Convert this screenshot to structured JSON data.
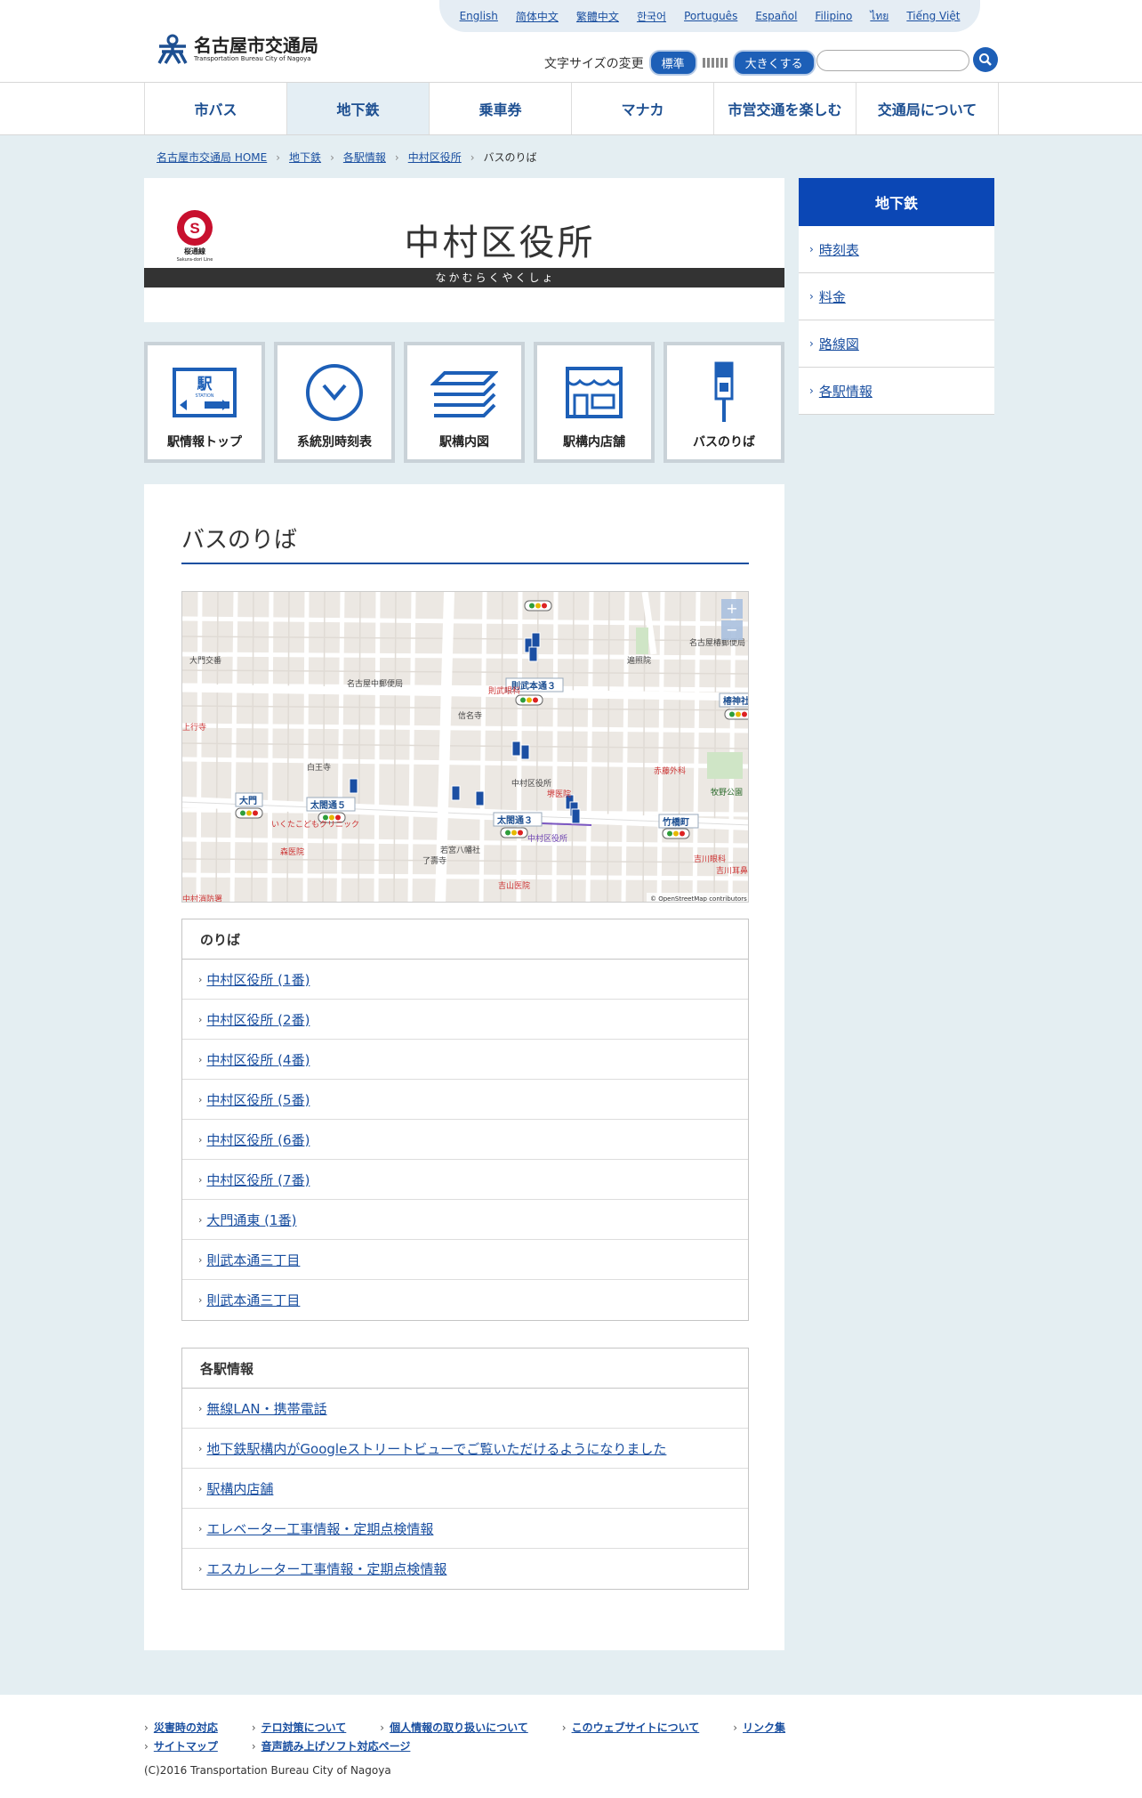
{
  "languages": [
    "English",
    "简体中文",
    "繁體中文",
    "한국어",
    "Português",
    "Español",
    "Filipino",
    "ไทย",
    "Tiếng Việt"
  ],
  "logo": {
    "title": "名古屋市交通局",
    "subtitle": "Transportation Bureau City of Nagoya"
  },
  "fontsize": {
    "label": "文字サイズの変更",
    "normal": "標準",
    "large": "大きくする"
  },
  "search": {
    "placeholder": ""
  },
  "nav": [
    "市バス",
    "地下鉄",
    "乗車券",
    "マナカ",
    "市営交通を楽しむ",
    "交通局について"
  ],
  "breadcrumb": [
    "名古屋市交通局 HOME",
    "地下鉄",
    "各駅情報",
    "中村区役所",
    "バスのりば"
  ],
  "station": {
    "line_letter": "S",
    "line_jp": "桜通線",
    "line_en": "Sakura-dori Line",
    "name": "中村区役所",
    "kana": "なかむらくやくしょ"
  },
  "tiles": [
    "駅情報トップ",
    "系統別時刻表",
    "駅構内図",
    "駅構内店舗",
    "バスのりば"
  ],
  "tile_sign": {
    "jp": "駅",
    "en": "STATION"
  },
  "side": {
    "head": "地下鉄",
    "items": [
      "時刻表",
      "料金",
      "路線図",
      "各駅情報"
    ]
  },
  "content": {
    "title": "バスのりば"
  },
  "map": {
    "labels": [
      "則武本通３",
      "大門",
      "太閤通５",
      "太閤通３",
      "竹橋町",
      "椿神社",
      "中村区役所",
      "中村区役所",
      "名古屋中郵便局",
      "則武眼科",
      "信名寺",
      "白王寺",
      "いくたこどもクリニック",
      "森医院",
      "了壽寺",
      "若宮八幡社",
      "吉山医院",
      "赤藤外科",
      "牧野公園",
      "遍照院",
      "上行寺",
      "大門交番",
      "堺医院",
      "名古屋椿郵便局",
      "吉川眼科",
      "中村消防署",
      "吉川耳鼻咽喉"
    ],
    "attribution": "© OpenStreetMap contributors",
    "zoom_in": "+",
    "zoom_out": "−"
  },
  "noriba": {
    "head": "のりば",
    "items": [
      "中村区役所 (1番)",
      "中村区役所 (2番)",
      "中村区役所 (4番)",
      "中村区役所 (5番)",
      "中村区役所 (6番)",
      "中村区役所 (7番)",
      "大門通東 (1番)",
      "則武本通三丁目",
      "則武本通三丁目"
    ]
  },
  "stationinfo": {
    "head": "各駅情報",
    "items": [
      "無線LAN・携帯電話",
      "地下鉄駅構内がGoogleストリートビューでご覧いただけるようになりました",
      "駅構内店舗",
      "エレベーター工事情報・定期点検情報",
      "エスカレーター工事情報・定期点検情報"
    ]
  },
  "footer": {
    "links": [
      "災害時の対応",
      "テロ対策について",
      "個人情報の取り扱いについて",
      "このウェブサイトについて",
      "リンク集",
      "サイトマップ",
      "音声読み上げソフト対応ページ"
    ],
    "copyright": "(C)2016 Transportation Bureau City of Nagoya"
  },
  "colors": {
    "primary": "#0b47b5",
    "line_sakura": "#c8102e",
    "bg": "#e4eef2"
  }
}
